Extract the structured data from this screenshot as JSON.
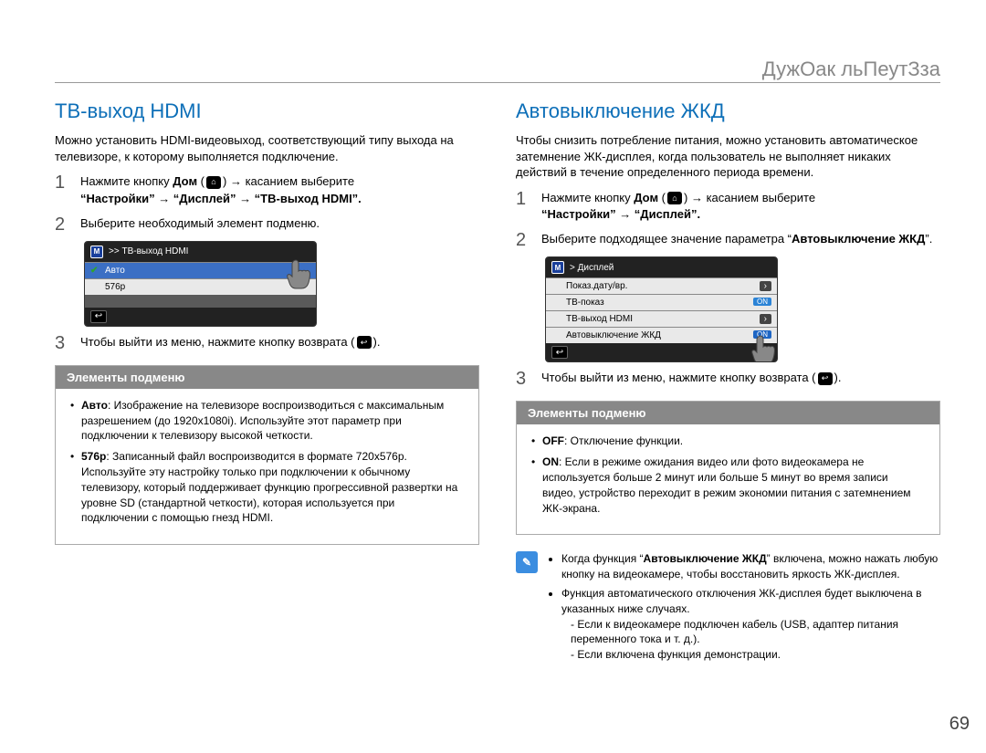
{
  "header": {
    "title": "ДужОак льПеутЗза"
  },
  "left": {
    "title": "ТВ-выход HDMI",
    "intro": "Можно установить HDMI-видеовыход, соответствующий типу выхода на телевизоре, к которому выполняется подключение.",
    "step1_a": "Нажмите кнопку ",
    "step1_bold1": "Дом",
    "step1_b": " → касанием выберите",
    "step1_line2": "“Настройки” → “Дисплей” → “ТВ-выход HDMI”.",
    "step2": "Выберите необходимый элемент подменю.",
    "ss_breadcrumb": ">> ТВ-выход HDMI",
    "ss_row1": "Авто",
    "ss_row2": "576p",
    "step3_a": "Чтобы выйти из меню, нажмите кнопку возврата (",
    "step3_b": ").",
    "sbox_title": "Элементы подменю",
    "item1_bold": "Авто",
    "item1_text": ": Изображение на телевизоре воспроизводиться с максимальным разрешением (до 1920x1080i). Используйте этот параметр при подключении к телевизору высокой четкости.",
    "item2_bold": "576p",
    "item2_text": ": Записанный файл воспроизводится в формате 720x576p. Используйте эту настройку только при подключении к обычному телевизору, который поддерживает функцию прогрессивной развертки на уровне SD (стандартной четкости), которая используется при подключении с помощью гнезд HDMI."
  },
  "right": {
    "title": "Автовыключение ЖКД",
    "intro": "Чтобы снизить потребление питания, можно установить автоматическое затемнение ЖК-дисплея, когда пользователь не выполняет никаких действий в течение определенного периода времени.",
    "step1_a": "Нажмите кнопку ",
    "step1_bold1": "Дом",
    "step1_b": " → касанием выберите",
    "step1_line2": "“Настройки” → “Дисплей”.",
    "step2_a": "Выберите подходящее значение параметра “",
    "step2_bold": "Автовыключение ЖКД",
    "step2_b": "”.",
    "ss_breadcrumb": "> Дисплей",
    "ss_rows": [
      {
        "label": "Показ.дату/вр.",
        "ctrl": "arrow"
      },
      {
        "label": "ТВ-показ",
        "ctrl": "on"
      },
      {
        "label": "ТВ-выход HDMI",
        "ctrl": "arrow"
      },
      {
        "label": "Автовыключение ЖКД",
        "ctrl": "on_sel"
      }
    ],
    "toggle_on": "ON",
    "step3_a": "Чтобы выйти из меню, нажмите кнопку возврата (",
    "step3_b": ").",
    "sbox_title": "Элементы подменю",
    "item1_bold": "OFF",
    "item1_text": ": Отключение функции.",
    "item2_bold": "ON",
    "item2_text": ": Если в режиме ожидания видео или фото видеокамера не используется больше 2 минут или больше 5 минут во время записи видео, устройство переходит в режим экономии питания с затемнением ЖК-экрана.",
    "note1_a": "Когда функция “",
    "note1_bold": "Автовыключение ЖКД",
    "note1_b": "” включена, можно нажать любую кнопку на видеокамере, чтобы восстановить яркость ЖК-дисплея.",
    "note2": "Функция автоматического отключения ЖК-дисплея будет выключена в указанных ниже случаях.",
    "note2_a": "- Если к видеокамере подключен кабель (USB, адаптер питания переменного тока и т. д.).",
    "note2_b": "- Если включена функция демонстрации."
  },
  "page": "69"
}
